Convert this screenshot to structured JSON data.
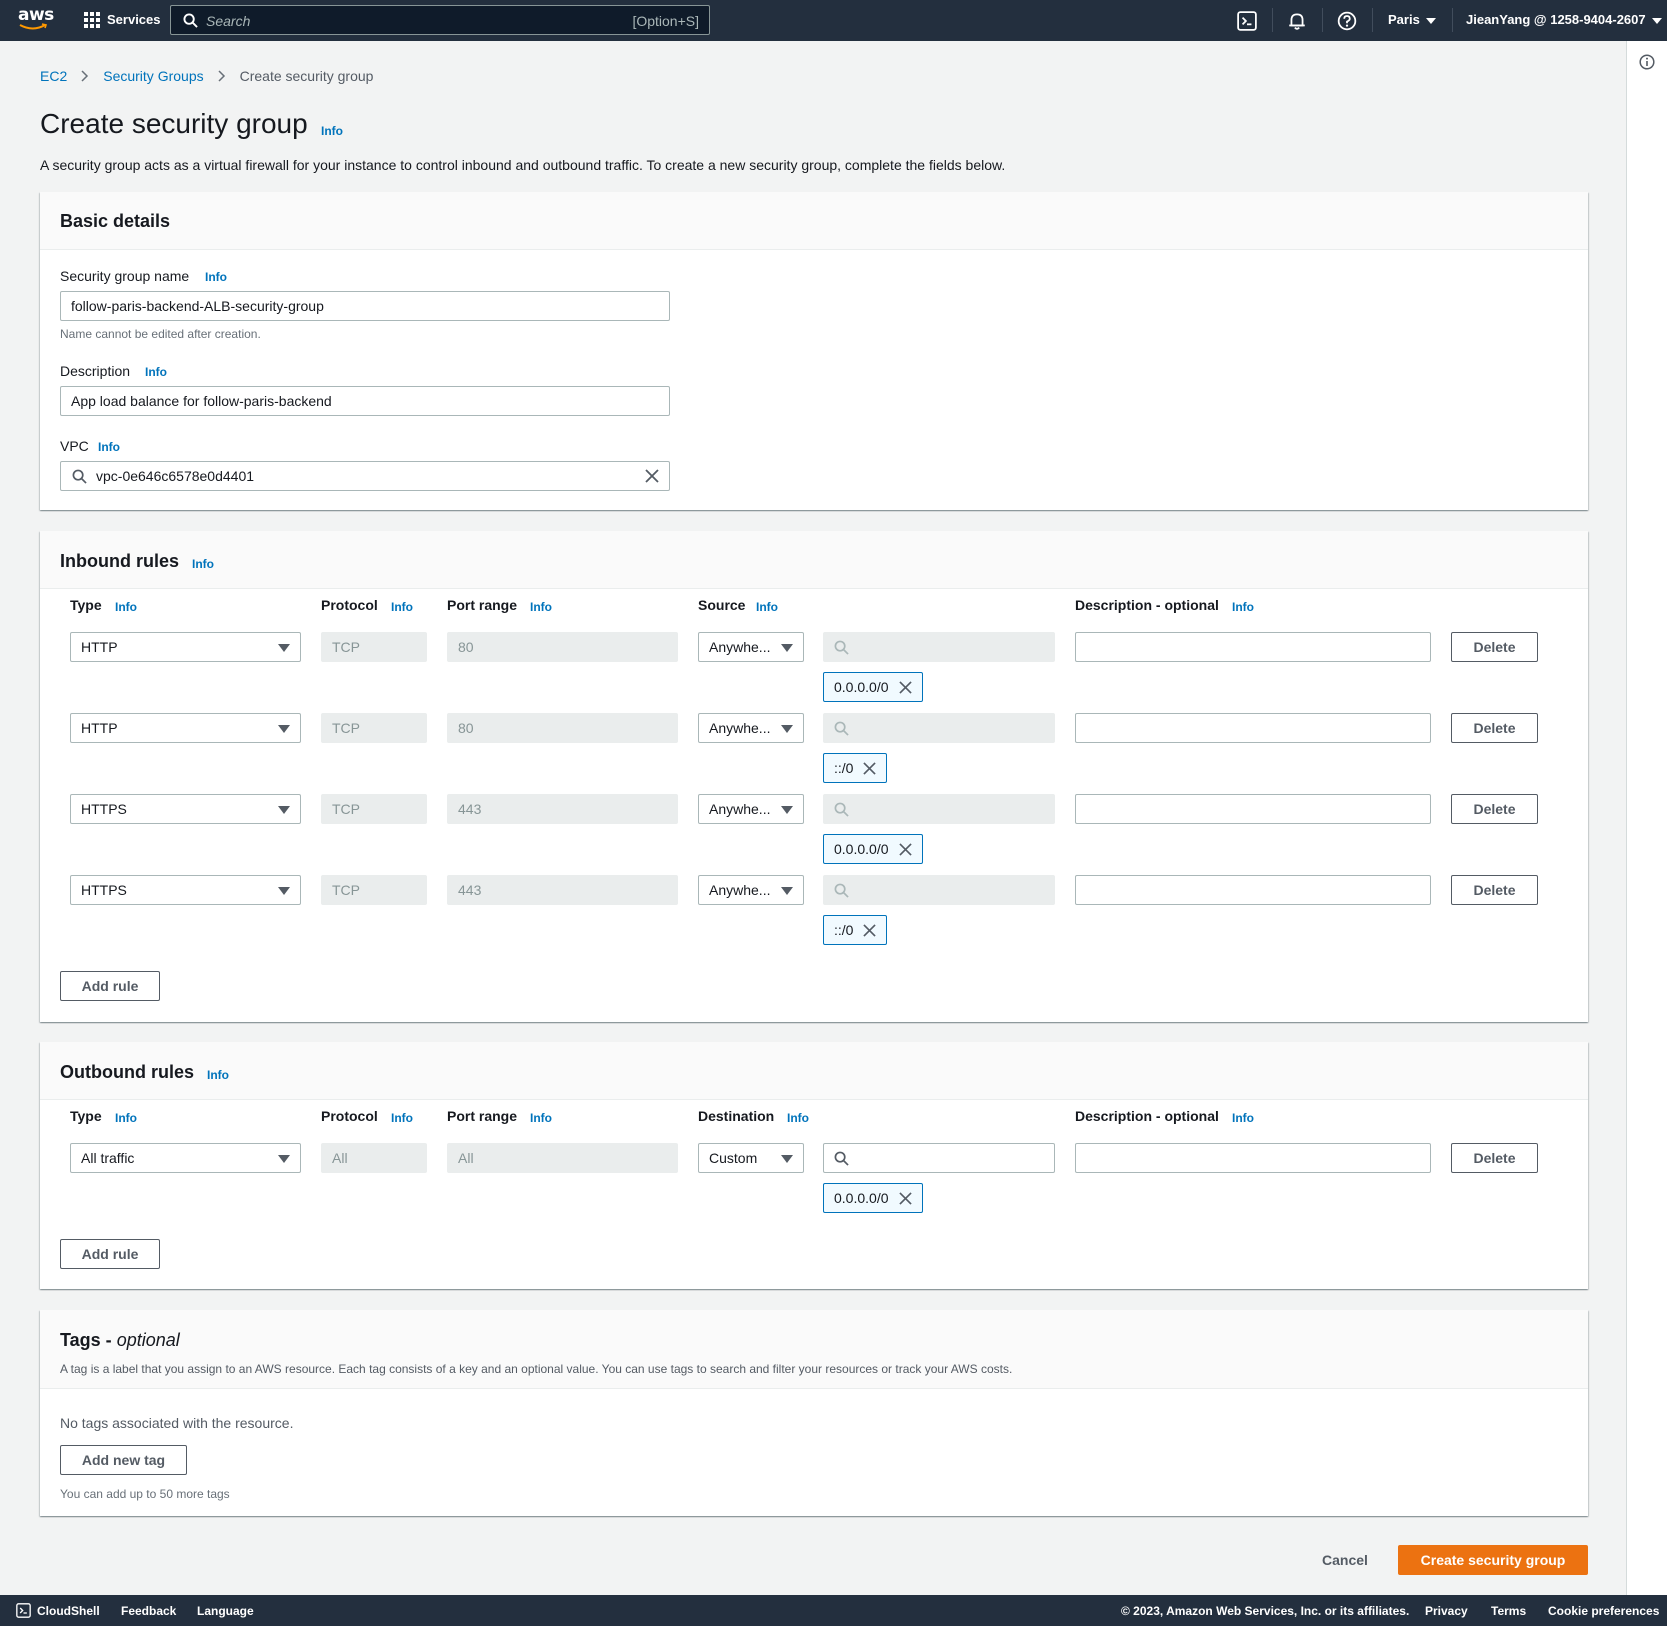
{
  "topnav": {
    "logo_text": "aws",
    "services_label": "Services",
    "search_placeholder": "Search",
    "search_shortcut": "[Option+S]",
    "region": "Paris",
    "account": "JieanYang @ 1258-9404-2607"
  },
  "breadcrumb": {
    "items": [
      "EC2",
      "Security Groups"
    ],
    "current": "Create security group"
  },
  "page": {
    "title": "Create security group",
    "info": "Info",
    "description": "A security group acts as a virtual firewall for your instance to control inbound and outbound traffic. To create a new security group, complete the fields below."
  },
  "basic_details": {
    "heading": "Basic details",
    "name_label": "Security group name",
    "name_value": "follow-paris-backend-ALB-security-group",
    "name_hint": "Name cannot be edited after creation.",
    "description_label": "Description",
    "description_value": "App load balance for follow-paris-backend",
    "vpc_label": "VPC",
    "vpc_value": "vpc-0e646c6578e0d4401",
    "info": "Info"
  },
  "inbound": {
    "heading": "Inbound rules",
    "info": "Info",
    "columns": {
      "type": "Type",
      "protocol": "Protocol",
      "port_range": "Port range",
      "source": "Source",
      "description": "Description - optional"
    },
    "rules": [
      {
        "type": "HTTP",
        "protocol": "TCP",
        "port": "80",
        "source": "Anywhe...",
        "cidr": "0.0.0.0/0",
        "delete": "Delete"
      },
      {
        "type": "HTTP",
        "protocol": "TCP",
        "port": "80",
        "source": "Anywhe...",
        "cidr": "::/0",
        "delete": "Delete"
      },
      {
        "type": "HTTPS",
        "protocol": "TCP",
        "port": "443",
        "source": "Anywhe...",
        "cidr": "0.0.0.0/0",
        "delete": "Delete"
      },
      {
        "type": "HTTPS",
        "protocol": "TCP",
        "port": "443",
        "source": "Anywhe...",
        "cidr": "::/0",
        "delete": "Delete"
      }
    ],
    "add_rule": "Add rule"
  },
  "outbound": {
    "heading": "Outbound rules",
    "info": "Info",
    "columns": {
      "type": "Type",
      "protocol": "Protocol",
      "port_range": "Port range",
      "destination": "Destination",
      "description": "Description - optional"
    },
    "rules": [
      {
        "type": "All traffic",
        "protocol": "All",
        "port": "All",
        "destination": "Custom",
        "cidr": "0.0.0.0/0",
        "delete": "Delete"
      }
    ],
    "add_rule": "Add rule"
  },
  "tags": {
    "heading": "Tags -",
    "heading_optional": "optional",
    "description": "A tag is a label that you assign to an AWS resource. Each tag consists of a key and an optional value. You can use tags to search and filter your resources or track your AWS costs.",
    "empty": "No tags associated with the resource.",
    "add_tag": "Add new tag",
    "hint": "You can add up to 50 more tags"
  },
  "actions": {
    "cancel": "Cancel",
    "create": "Create security group"
  },
  "footer": {
    "cloudshell": "CloudShell",
    "feedback": "Feedback",
    "language": "Language",
    "copyright": "© 2023, Amazon Web Services, Inc. or its affiliates.",
    "privacy": "Privacy",
    "terms": "Terms",
    "cookies": "Cookie preferences"
  },
  "colors": {
    "nav_bg": "#232f3e",
    "link": "#0073bb",
    "primary": "#ec7211"
  }
}
